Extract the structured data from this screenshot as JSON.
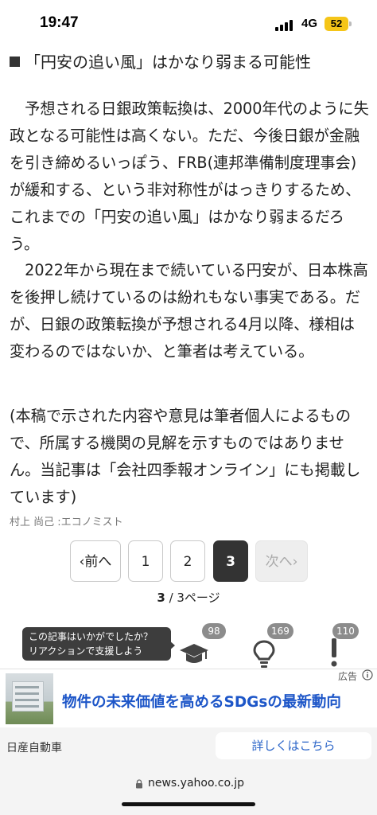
{
  "status_bar": {
    "time": "19:47",
    "network": "4G",
    "battery": "52"
  },
  "article": {
    "heading": "「円安の追い風」はかなり弱まる可能性",
    "paragraphs": [
      "　予想される日銀政策転換は、2000年代のように失政となる可能性は高くない。ただ、今後日銀が金融を引き締めるいっぽう、FRB(連邦準備制度理事会)が緩和する、という非対称性がはっきりするため、これまでの「円安の追い風」はかなり弱まるだろう。",
      "　2022年から現在まで続いている円安が、日本株高を後押し続けているのは紛れもない事実である。だが、日銀の政策転換が予想される4月以降、様相は変わるのではないか、と筆者は考えている。",
      "(本稿で示された内容や意見は筆者個人によるもので、所属する機関の見解を示すものではありません。当記事は「会社四季報オンライン」にも掲載しています)"
    ],
    "author": "村上 尚己 :エコノミスト"
  },
  "pagination": {
    "prev_label": "前へ",
    "next_label": "次へ",
    "pages": [
      "1",
      "2",
      "3"
    ],
    "current": "3",
    "total_suffix": "/ 3ページ"
  },
  "reactions": {
    "prompt_line1": "この記事はいかがでしたか？",
    "prompt_line2": "リアクションで支援しよう",
    "items": [
      {
        "icon": "graduation-cap-icon",
        "count": "98"
      },
      {
        "icon": "lightbulb-icon",
        "count": "169"
      },
      {
        "icon": "exclamation-icon",
        "count": "110"
      }
    ]
  },
  "ad": {
    "label": "広告",
    "title": "物件の未来価値を高めるSDGsの最新動向",
    "advertiser": "日産自動車",
    "cta": "詳しくはこちら",
    "title_color": "#1d56c8"
  },
  "browser": {
    "url": "news.yahoo.co.jp"
  }
}
